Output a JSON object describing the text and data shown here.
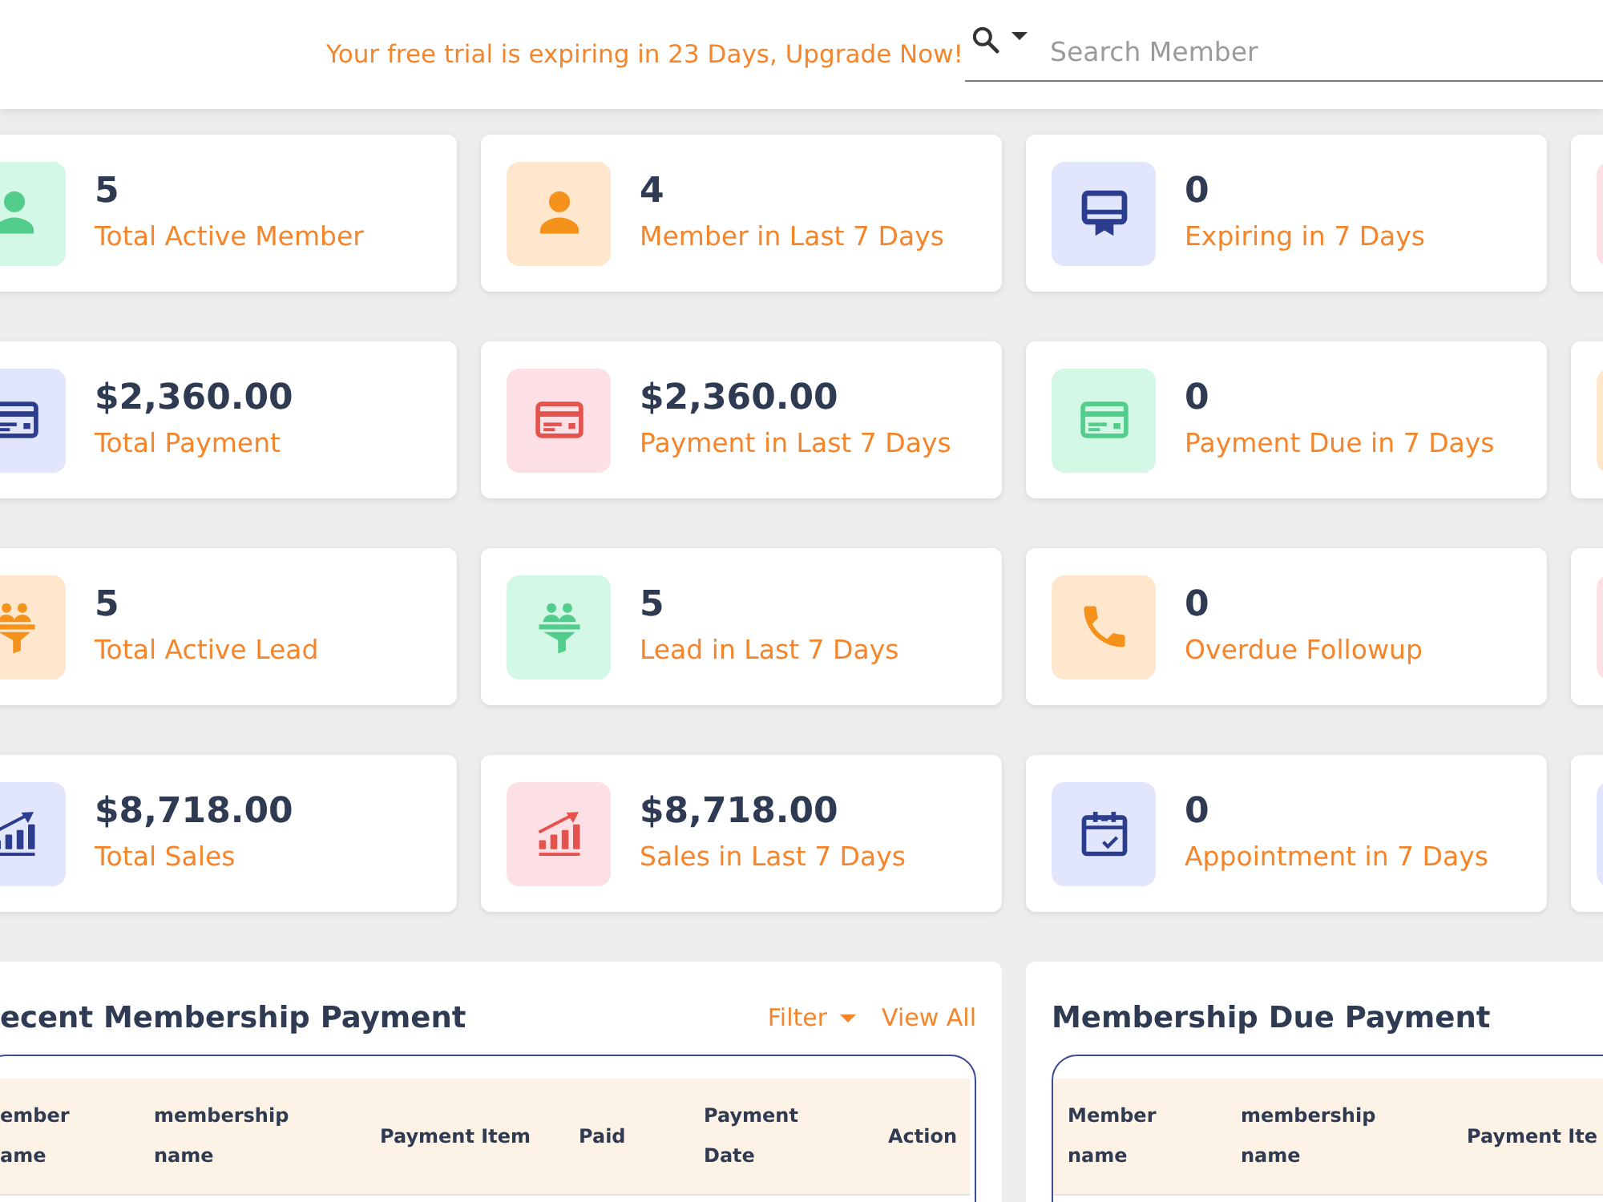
{
  "top_bar": {
    "trial_notice": "Your free trial is expiring in 23 Days, Upgrade Now!",
    "search": {
      "placeholder": "Search Member"
    }
  },
  "stat_cards": [
    {
      "color": "#d3f8e6",
      "icon": {
        "kind": "member",
        "color": "#52cd8c"
      },
      "value": "5",
      "label": "Total Active Member"
    },
    {
      "color": "#ffe7cd",
      "icon": {
        "kind": "member",
        "color": "#f4921c"
      },
      "value": "4",
      "label": "Member in Last 7 Days"
    },
    {
      "color": "#e1e6fc",
      "icon": {
        "kind": "expiring",
        "color": "#2d3d8e"
      },
      "value": "0",
      "label": "Expiring in 7 Days"
    },
    {
      "color": "#fde0e5"
    },
    {
      "color": "#e1e6fc",
      "icon": {
        "kind": "payment",
        "color": "#2d3d8e"
      },
      "value": "$2,360.00",
      "label": "Total Payment"
    },
    {
      "color": "#fde0e5",
      "icon": {
        "kind": "payment",
        "color": "#e5534f"
      },
      "value": "$2,360.00",
      "label": "Payment in Last 7 Days"
    },
    {
      "color": "#d3f8e6",
      "icon": {
        "kind": "payment",
        "color": "#52cd8c"
      },
      "value": "0",
      "label": "Payment Due in 7 Days"
    },
    {
      "color": "#ffe7cd"
    },
    {
      "color": "#ffe7cd",
      "icon": {
        "kind": "lead",
        "color": "#f4921c"
      },
      "value": "5",
      "label": "Total Active Lead"
    },
    {
      "color": "#d3f8e6",
      "icon": {
        "kind": "lead",
        "color": "#52cd8c"
      },
      "value": "5",
      "label": "Lead in Last 7 Days"
    },
    {
      "color": "#ffe7cd",
      "icon": {
        "kind": "followup",
        "color": "#f4921c"
      },
      "value": "0",
      "label": "Overdue Followup"
    },
    {
      "color": "#fde0e5"
    },
    {
      "color": "#e1e6fc",
      "icon": {
        "kind": "sales",
        "color": "#2d3d8e"
      },
      "value": "$8,718.00",
      "label": "Total Sales"
    },
    {
      "color": "#fde0e5",
      "icon": {
        "kind": "sales",
        "color": "#e5534f"
      },
      "value": "$8,718.00",
      "label": "Sales in Last 7 Days"
    },
    {
      "color": "#e1e6fc",
      "icon": {
        "kind": "appointment",
        "color": "#2d3d8e"
      },
      "value": "0",
      "label": "Appointment in 7 Days"
    },
    {
      "color": "#e1e6fc"
    }
  ],
  "panels": [
    {
      "title": "ecent Membership Payment",
      "actions": [
        {
          "kind": "dropdown",
          "label": "Filter"
        },
        {
          "kind": "link",
          "label": "View All"
        }
      ],
      "table": {
        "columns": [
          "ember ame",
          "membership name",
          "Payment Item",
          "Paid",
          "Payment Date",
          "Action"
        ]
      }
    },
    {
      "title": "Membership Due Payment",
      "table": {
        "columns": [
          "Member name",
          "membership name",
          "Payment Ite"
        ]
      }
    }
  ]
}
